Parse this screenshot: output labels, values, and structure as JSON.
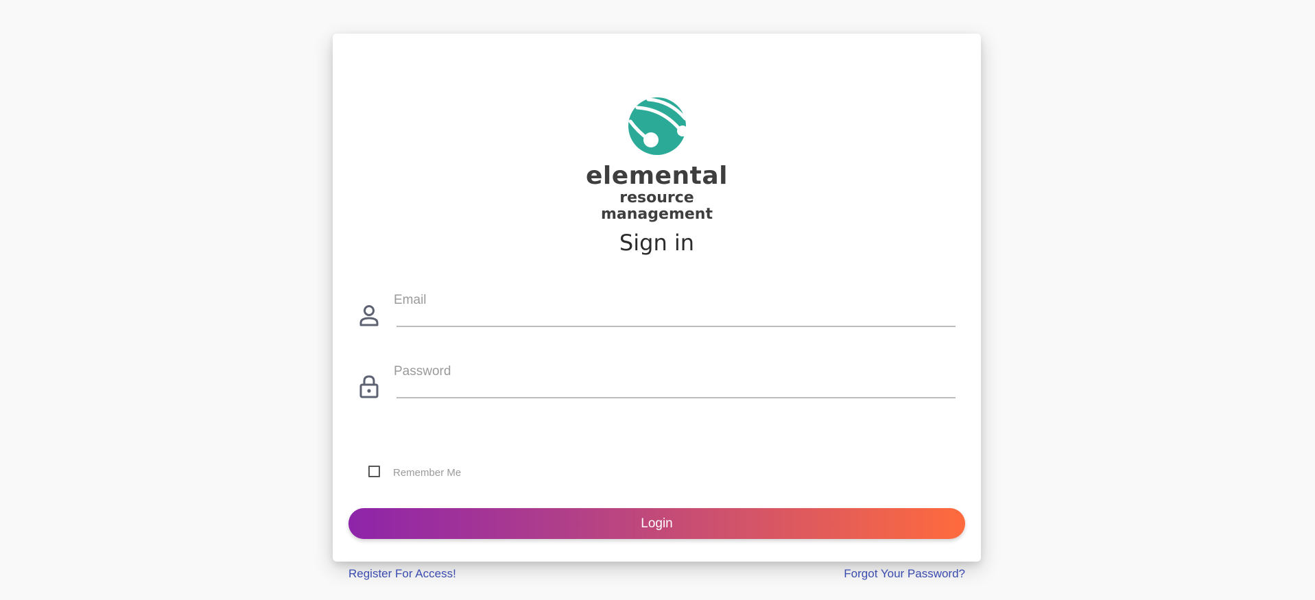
{
  "brand": {
    "name_line1": "elemental",
    "name_line2": "resource",
    "name_line3": "management",
    "logo_icon": "globe-network-icon",
    "logo_color": "#2aaa97"
  },
  "form": {
    "title": "Sign in",
    "email": {
      "label": "Email",
      "value": "",
      "icon": "user-icon"
    },
    "password": {
      "label": "Password",
      "value": "",
      "icon": "lock-icon"
    },
    "remember_me": {
      "label": "Remember Me",
      "checked": false
    },
    "login_button": "Login",
    "gradient_start": "#8e24aa",
    "gradient_end": "#ff6b3d"
  },
  "links": {
    "register": "Register For Access!",
    "forgot_password": "Forgot Your Password?",
    "color": "#3a4bb0"
  }
}
